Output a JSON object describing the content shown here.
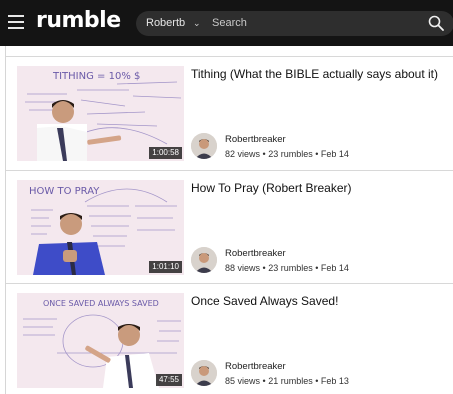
{
  "header": {
    "logo": "rumble",
    "channel_filter": "Robertb",
    "search_placeholder": "Search"
  },
  "videos": [
    {
      "title": "Tithing (What the BIBLE actually says about it)",
      "duration": "1:00:58",
      "channel": "Robertbreaker",
      "views": "82 views",
      "rumbles": "23 rumbles",
      "date": "Feb 14",
      "thumb_text": "TITHING = 10% $",
      "separator": "•"
    },
    {
      "title": "How To Pray (Robert Breaker)",
      "duration": "1:01:10",
      "channel": "Robertbreaker",
      "views": "88 views",
      "rumbles": "23 rumbles",
      "date": "Feb 14",
      "thumb_text": "HOW TO PRAY",
      "separator": "•"
    },
    {
      "title": "Once Saved Always Saved!",
      "duration": "47:55",
      "channel": "Robertbreaker",
      "views": "85 views",
      "rumbles": "21 rumbles",
      "date": "Feb 13",
      "thumb_text": "ONCE SAVED ALWAYS SAVED",
      "separator": "•"
    }
  ]
}
